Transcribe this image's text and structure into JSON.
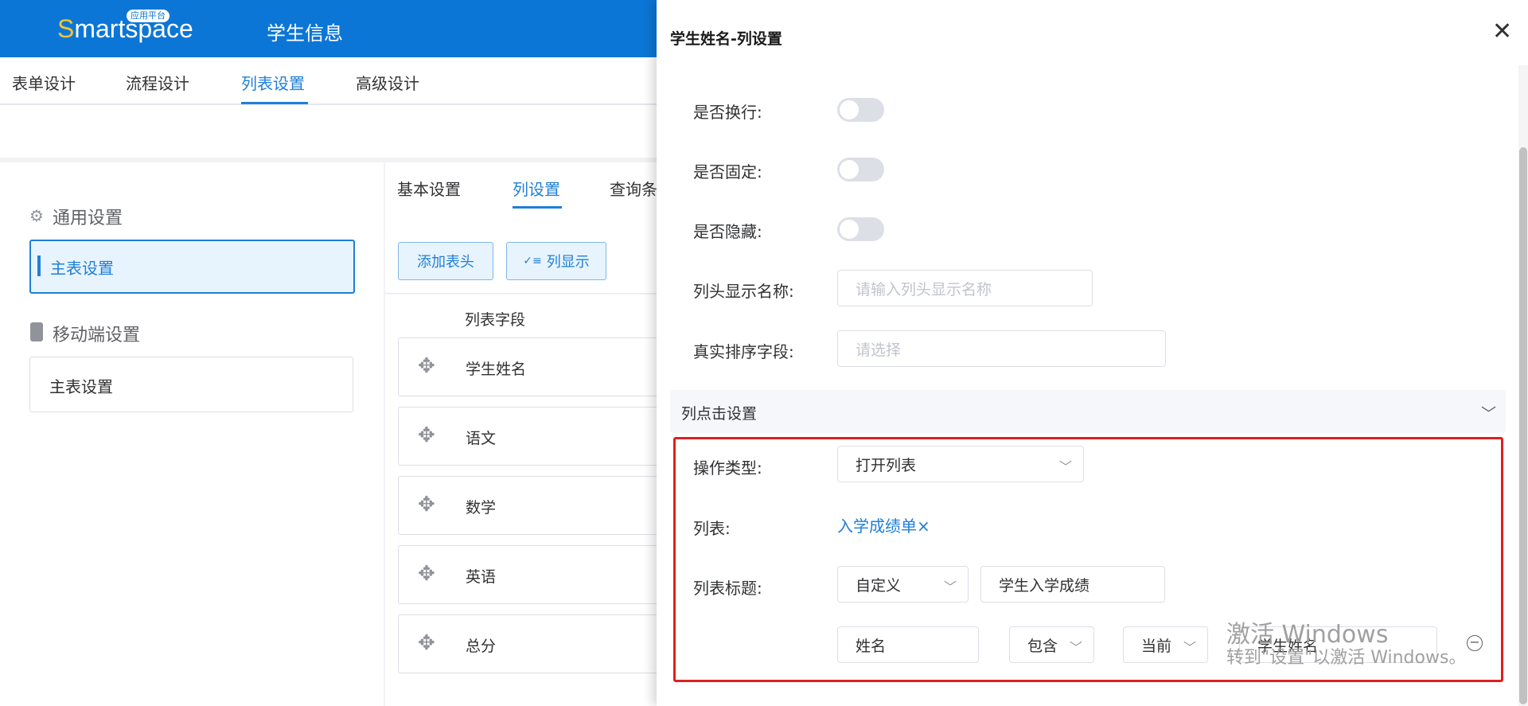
{
  "header": {
    "logo": "Smartspace",
    "logo_first": "S",
    "logo_rest": "martspace",
    "logo_badge": "应用平台",
    "app_title": "学生信息"
  },
  "main_tabs": [
    "表单设计",
    "流程设计",
    "列表设置",
    "高级设计"
  ],
  "left_panel": {
    "general_title": "通用设置",
    "general_item": "主表设置",
    "mobile_title": "移动端设置",
    "mobile_item": "主表设置"
  },
  "sub_tabs": [
    "基本设置",
    "列设置",
    "查询条"
  ],
  "buttons": {
    "add_header": "添加表头",
    "column_display": "列显示"
  },
  "fields": {
    "header": "列表字段",
    "rows": [
      "学生姓名",
      "语文",
      "数学",
      "英语",
      "总分"
    ]
  },
  "drawer": {
    "title": "学生姓名-列设置",
    "wrap_label": "是否换行:",
    "fixed_label": "是否固定:",
    "hidden_label": "是否隐藏:",
    "display_name_label": "列头显示名称:",
    "display_name_placeholder": "请输入列头显示名称",
    "sort_field_label": "真实排序字段:",
    "sort_field_placeholder": "请选择",
    "click_section": "列点击设置",
    "op_type_label": "操作类型:",
    "op_type_value": "打开列表",
    "list_label": "列表:",
    "list_value": "入学成绩单",
    "list_remove": "×",
    "list_title_label": "列表标题:",
    "list_title_mode": "自定义",
    "list_title_value": "学生入学成绩",
    "filter": {
      "field": "姓名",
      "operator": "包含",
      "scope": "当前",
      "value": "学生姓名"
    }
  },
  "watermark": {
    "line1": "激活 Windows",
    "line2": "转到\"设置\"以激活 Windows。"
  }
}
